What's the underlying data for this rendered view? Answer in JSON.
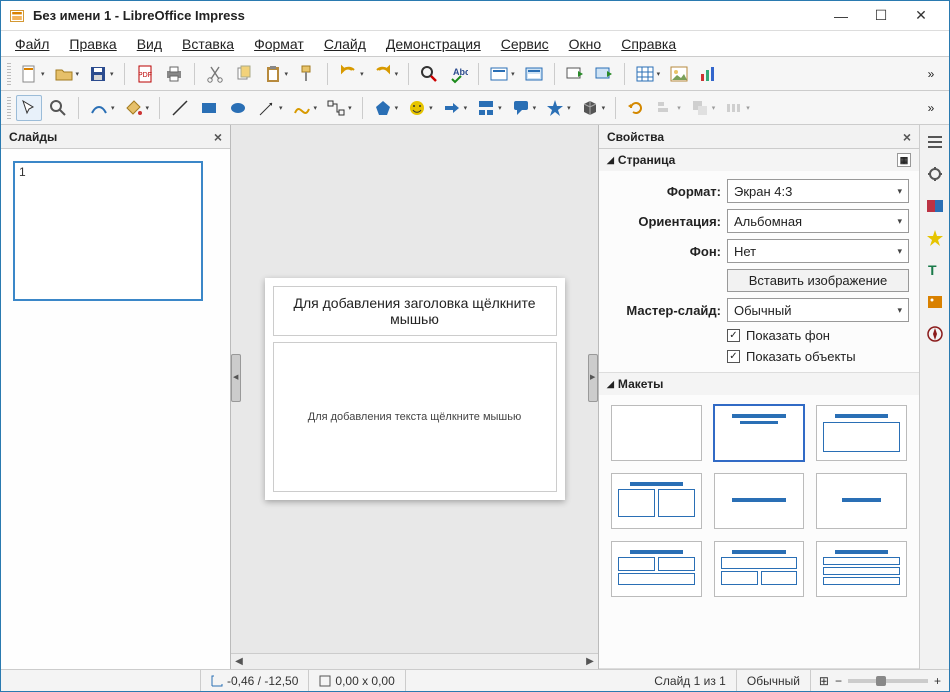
{
  "window": {
    "title": "Без имени 1 - LibreOffice Impress"
  },
  "menu": {
    "file": "Файл",
    "edit": "Правка",
    "view": "Вид",
    "insert": "Вставка",
    "format": "Формат",
    "slide": "Слайд",
    "slideshow": "Демонстрация",
    "tools": "Сервис",
    "window": "Окно",
    "help": "Справка"
  },
  "panels": {
    "slides_title": "Слайды",
    "properties_title": "Свойства"
  },
  "slide_thumb": {
    "number": "1"
  },
  "canvas": {
    "title_placeholder": "Для добавления заголовка щёлкните мышью",
    "content_placeholder": "Для добавления текста щёлкните мышью"
  },
  "page_section": {
    "heading": "Страница",
    "format_label": "Формат:",
    "format_value": "Экран 4:3",
    "orientation_label": "Ориентация:",
    "orientation_value": "Альбомная",
    "background_label": "Фон:",
    "background_value": "Нет",
    "insert_image": "Вставить изображение",
    "master_label": "Мастер-слайд:",
    "master_value": "Обычный",
    "show_background": "Показать фон",
    "show_objects": "Показать объекты"
  },
  "layouts_section": {
    "heading": "Макеты"
  },
  "status": {
    "coords": "-0,46 / -12,50",
    "size": "0,00 x 0,00",
    "slide_count": "Слайд 1 из 1",
    "master": "Обычный"
  }
}
